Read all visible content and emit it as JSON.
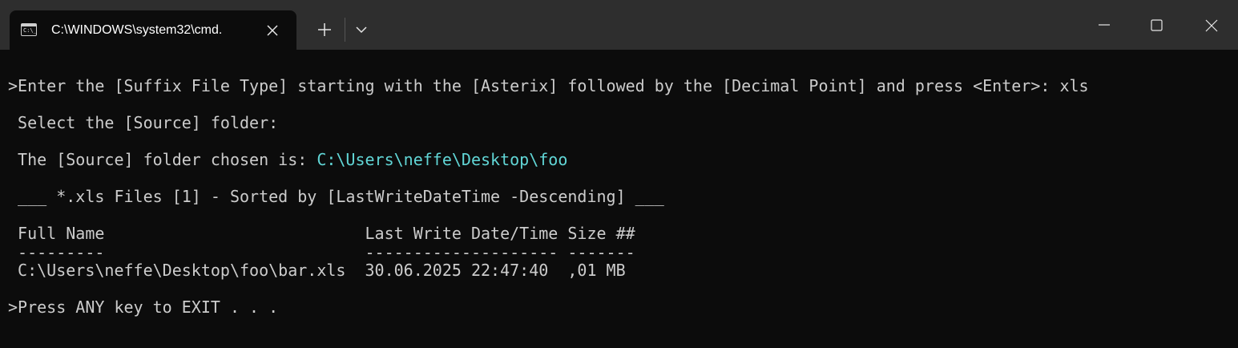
{
  "window": {
    "tab_title": "C:\\WINDOWS\\system32\\cmd.",
    "tab_icon": "cmd-icon",
    "icons": {
      "close_tab": "close-icon",
      "new_tab": "plus-icon",
      "dropdown": "chevron-down-icon",
      "minimize": "minimize-icon",
      "maximize": "maximize-icon",
      "close_window": "close-icon"
    }
  },
  "colors": {
    "background": "#0c0c0c",
    "titlebar": "#2e2e2e",
    "text": "#cccccc",
    "path_accent": "#61d6d6"
  },
  "terminal": {
    "line1": ">Enter the [Suffix File Type] starting with the [Asterix] followed by the [Decimal Point] and press <Enter>: xls",
    "line2": " Select the [Source] folder:",
    "line3_prefix": " The [Source] folder chosen is: ",
    "line3_path": "C:\\Users\\neffe\\Desktop\\foo",
    "line4": " ___ *.xls Files [1] - Sorted by [LastWriteDateTime -Descending] ___",
    "table": {
      "header": " Full Name                           Last Write Date/Time Size ##",
      "underline": " ---------                           -------------------- -------",
      "row": " C:\\Users\\neffe\\Desktop\\foo\\bar.xls  30.06.2025 22:47:40  ,01 MB"
    },
    "line_exit": ">Press ANY key to EXIT . . ."
  }
}
